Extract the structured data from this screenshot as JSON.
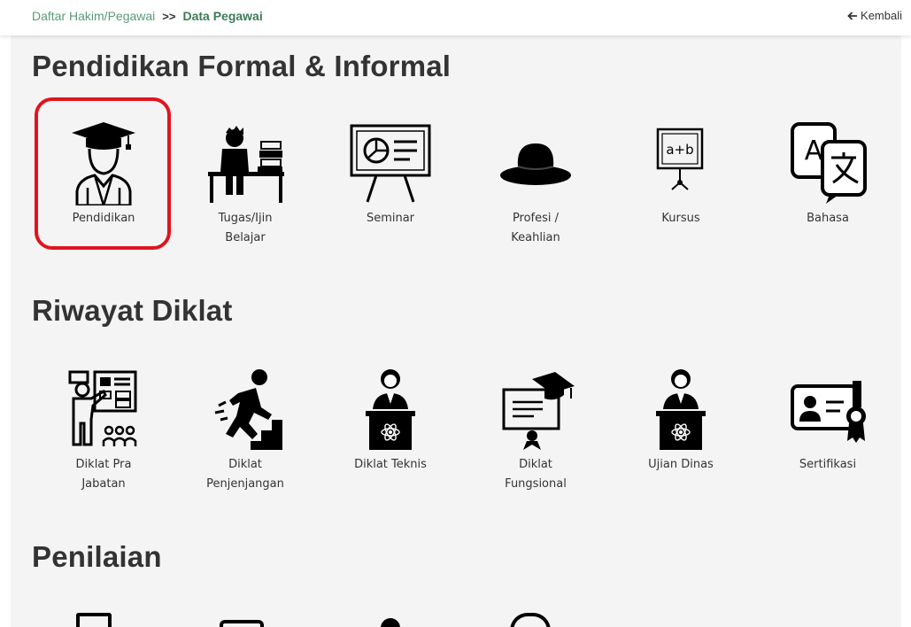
{
  "breadcrumb": {
    "parent": "Daftar Hakim/Pegawai",
    "separator": ">>",
    "current": "Data Pegawai"
  },
  "back_button": {
    "label": "Kembali",
    "icon": "arrow-left-icon"
  },
  "sections": [
    {
      "title": "Pendidikan Formal & Informal",
      "items": [
        {
          "label": "Pendidikan",
          "icon": "graduate-icon",
          "selected": true
        },
        {
          "label": "Tugas/Ijin Belajar",
          "icon": "student-desk-icon"
        },
        {
          "label": "Seminar",
          "icon": "presentation-board-icon"
        },
        {
          "label": "Profesi / Keahlian",
          "icon": "hat-icon"
        },
        {
          "label": "Kursus",
          "icon": "whiteboard-icon"
        },
        {
          "label": "Bahasa",
          "icon": "translate-icon"
        }
      ]
    },
    {
      "title": "Riwayat Diklat",
      "items": [
        {
          "label": "Diklat Pra Jabatan",
          "icon": "teacher-class-icon"
        },
        {
          "label": "Diklat Penjenjangan",
          "icon": "climbing-stairs-icon"
        },
        {
          "label": "Diklat Teknis",
          "icon": "speaker-podium-icon"
        },
        {
          "label": "Diklat Fungsional",
          "icon": "certificate-diploma-icon"
        },
        {
          "label": "Ujian Dinas",
          "icon": "speaker-podium-icon"
        },
        {
          "label": "Sertifikasi",
          "icon": "id-certificate-icon"
        }
      ]
    },
    {
      "title": "Penilaian",
      "items": []
    }
  ],
  "colors": {
    "highlight": "#e0141e",
    "breadcrumb": "#4a8f6a",
    "icon": "#000000"
  }
}
